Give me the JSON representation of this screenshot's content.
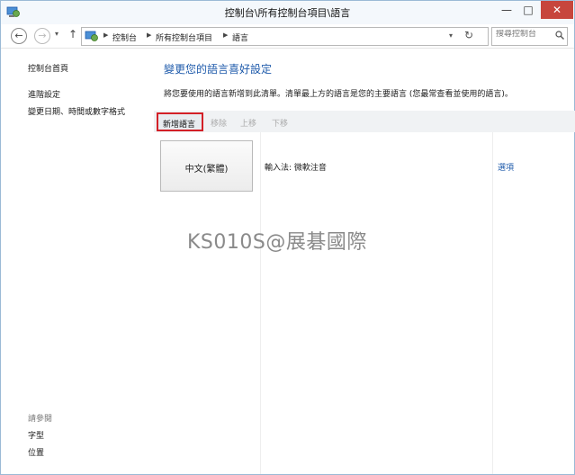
{
  "window": {
    "title": "控制台\\所有控制台項目\\語言",
    "minimize_label": "—",
    "maximize_label": "□",
    "close_label": "✕",
    "icon": "control-panel-icon"
  },
  "nav": {
    "back_icon": "←",
    "forward_icon": "→",
    "dropdown_icon": "▾",
    "up_icon": "↑",
    "refresh_icon": "↻",
    "breadcrumbs": [
      "控制台",
      "所有控制台項目",
      "語言"
    ],
    "search_placeholder": "搜尋控制台"
  },
  "sidebar": {
    "home": "控制台首頁",
    "advanced": "進階設定",
    "date_format": "變更日期、時間或數字格式",
    "see_also_title": "請參閱",
    "fonts": "字型",
    "location": "位置"
  },
  "main": {
    "title": "變更您的語言喜好設定",
    "description": "將您要使用的語言新增到此清單。清單最上方的語言是您的主要語言 (您最常查看並使用的語言)。",
    "toolbar": {
      "add": "新增語言",
      "remove": "移除",
      "move_up": "上移",
      "move_down": "下移"
    },
    "languages": [
      {
        "name": "中文(繁體)",
        "ime": "輸入法: 微軟注音",
        "options": "選項"
      }
    ]
  },
  "watermark": "KS010S@展碁國際",
  "colors": {
    "accent": "#1f5bab",
    "highlight": "#d32027",
    "close": "#c7463c"
  }
}
